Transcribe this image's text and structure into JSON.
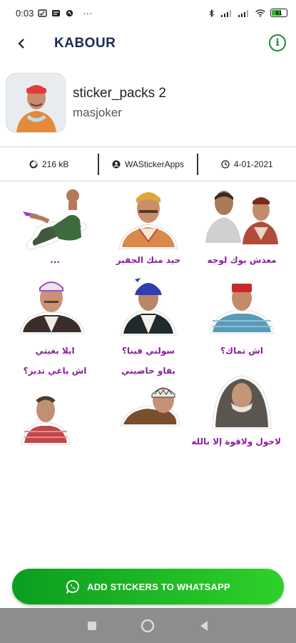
{
  "status_bar": {
    "time": "0:03",
    "more": "···",
    "battery_level": "61",
    "colors": {
      "battery_fill": "#2eb82e"
    }
  },
  "app_bar": {
    "back_icon": "arrow-back-icon",
    "title": "KABOUR",
    "info_icon": "info-icon"
  },
  "pack": {
    "name": "sticker_packs 2",
    "publisher": "masjoker"
  },
  "info": {
    "size": "216 kB",
    "author": "WAStickerApps",
    "date": "4-01-2021"
  },
  "stickers": [
    {
      "caption": "..."
    },
    {
      "caption": "حيد منك الجقير"
    },
    {
      "caption": "معدش بوك لوجه"
    },
    {
      "caption": "ايلا بغيتي"
    },
    {
      "caption": "سولني فينا؟"
    },
    {
      "caption": "اش تماك؟"
    },
    {
      "caption": "اش باغي تدير؟"
    },
    {
      "caption": "بقاو حاضيني"
    },
    {
      "caption": "لاحول ولاقوة إلا بالله"
    }
  ],
  "add_button": {
    "label": "ADD STICKERS TO WHATSAPP",
    "icon": "whatsapp-icon",
    "colors": {
      "start": "#0c9d1f",
      "end": "#2fd12a"
    }
  },
  "nav_bar": {
    "recent_icon": "square-icon",
    "home_icon": "circle-icon",
    "back_icon": "triangle-back-icon"
  }
}
